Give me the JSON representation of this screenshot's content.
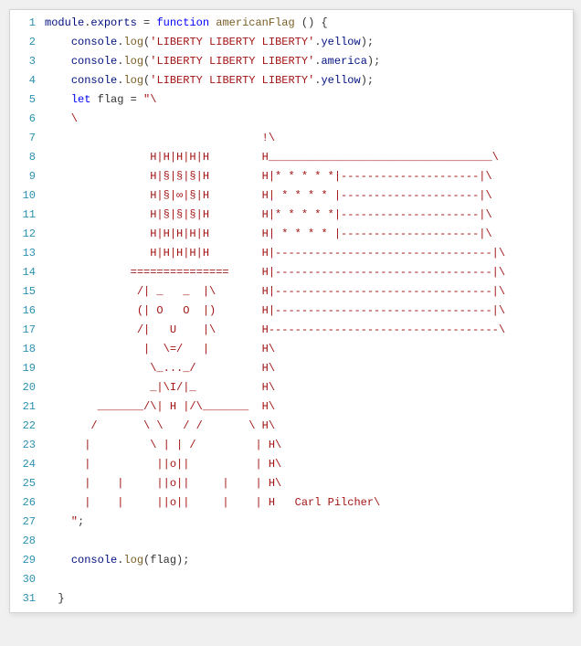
{
  "lines": [
    {
      "n": "1",
      "frags": [
        {
          "t": "module",
          "c": "prop"
        },
        {
          "t": ".",
          "c": "punc"
        },
        {
          "t": "exports",
          "c": "prop"
        },
        {
          "t": " = ",
          "c": "punc"
        },
        {
          "t": "function",
          "c": "kw"
        },
        {
          "t": " ",
          "c": "punc"
        },
        {
          "t": "americanFlag",
          "c": "fn"
        },
        {
          "t": " () {",
          "c": "punc"
        }
      ]
    },
    {
      "n": "2",
      "frags": [
        {
          "t": "    ",
          "c": "punc"
        },
        {
          "t": "console",
          "c": "prop"
        },
        {
          "t": ".",
          "c": "punc"
        },
        {
          "t": "log",
          "c": "fn"
        },
        {
          "t": "(",
          "c": "punc"
        },
        {
          "t": "'LIBERTY LIBERTY LIBERTY'",
          "c": "str"
        },
        {
          "t": ".",
          "c": "punc"
        },
        {
          "t": "yellow",
          "c": "prop"
        },
        {
          "t": ");",
          "c": "punc"
        }
      ]
    },
    {
      "n": "3",
      "frags": [
        {
          "t": "    ",
          "c": "punc"
        },
        {
          "t": "console",
          "c": "prop"
        },
        {
          "t": ".",
          "c": "punc"
        },
        {
          "t": "log",
          "c": "fn"
        },
        {
          "t": "(",
          "c": "punc"
        },
        {
          "t": "'LIBERTY LIBERTY LIBERTY'",
          "c": "str"
        },
        {
          "t": ".",
          "c": "punc"
        },
        {
          "t": "america",
          "c": "prop"
        },
        {
          "t": ");",
          "c": "punc"
        }
      ]
    },
    {
      "n": "4",
      "frags": [
        {
          "t": "    ",
          "c": "punc"
        },
        {
          "t": "console",
          "c": "prop"
        },
        {
          "t": ".",
          "c": "punc"
        },
        {
          "t": "log",
          "c": "fn"
        },
        {
          "t": "(",
          "c": "punc"
        },
        {
          "t": "'LIBERTY LIBERTY LIBERTY'",
          "c": "str"
        },
        {
          "t": ".",
          "c": "punc"
        },
        {
          "t": "yellow",
          "c": "prop"
        },
        {
          "t": ");",
          "c": "punc"
        }
      ]
    },
    {
      "n": "5",
      "frags": [
        {
          "t": "    ",
          "c": "punc"
        },
        {
          "t": "let",
          "c": "kw"
        },
        {
          "t": " flag = ",
          "c": "punc"
        },
        {
          "t": "\"\\",
          "c": "str"
        }
      ]
    },
    {
      "n": "6",
      "frags": [
        {
          "t": "    \\",
          "c": "str"
        }
      ]
    },
    {
      "n": "7",
      "frags": [
        {
          "t": "                                 !\\",
          "c": "str"
        }
      ]
    },
    {
      "n": "8",
      "frags": [
        {
          "t": "                H|H|H|H|H        H__________________________________\\",
          "c": "str"
        }
      ]
    },
    {
      "n": "9",
      "frags": [
        {
          "t": "                H|§|§|§|H        H|* * * * *|---------------------|\\",
          "c": "str"
        }
      ]
    },
    {
      "n": "10",
      "frags": [
        {
          "t": "                H|§|∞|§|H        H| * * * * |---------------------|\\",
          "c": "str"
        }
      ]
    },
    {
      "n": "11",
      "frags": [
        {
          "t": "                H|§|§|§|H        H|* * * * *|---------------------|\\",
          "c": "str"
        }
      ]
    },
    {
      "n": "12",
      "frags": [
        {
          "t": "                H|H|H|H|H        H| * * * * |---------------------|\\",
          "c": "str"
        }
      ]
    },
    {
      "n": "13",
      "frags": [
        {
          "t": "                H|H|H|H|H        H|---------------------------------|\\",
          "c": "str"
        }
      ]
    },
    {
      "n": "14",
      "frags": [
        {
          "t": "             ===============     H|---------------------------------|\\",
          "c": "str"
        }
      ]
    },
    {
      "n": "15",
      "frags": [
        {
          "t": "              /| _   _  |\\       H|---------------------------------|\\",
          "c": "str"
        }
      ]
    },
    {
      "n": "16",
      "frags": [
        {
          "t": "              (| O   O  |)       H|---------------------------------|\\",
          "c": "str"
        }
      ]
    },
    {
      "n": "17",
      "frags": [
        {
          "t": "              /|   U    |\\       H-----------------------------------\\",
          "c": "str"
        }
      ]
    },
    {
      "n": "18",
      "frags": [
        {
          "t": "               |  \\=/   |        H\\",
          "c": "str"
        }
      ]
    },
    {
      "n": "19",
      "frags": [
        {
          "t": "                \\_..._/          H\\",
          "c": "str"
        }
      ]
    },
    {
      "n": "20",
      "frags": [
        {
          "t": "                _|\\I/|_          H\\",
          "c": "str"
        }
      ]
    },
    {
      "n": "21",
      "frags": [
        {
          "t": "        _______/\\| H |/\\_______  H\\",
          "c": "str"
        }
      ]
    },
    {
      "n": "22",
      "frags": [
        {
          "t": "       /       \\ \\   / /       \\ H\\",
          "c": "str"
        }
      ]
    },
    {
      "n": "23",
      "frags": [
        {
          "t": "      |         \\ | | /         | H\\",
          "c": "str"
        }
      ]
    },
    {
      "n": "24",
      "frags": [
        {
          "t": "      |          ||o||          | H\\",
          "c": "str"
        }
      ]
    },
    {
      "n": "25",
      "frags": [
        {
          "t": "      |    |     ||o||     |    | H\\",
          "c": "str"
        }
      ]
    },
    {
      "n": "26",
      "frags": [
        {
          "t": "      |    |     ||o||     |    | H   Carl Pilcher\\",
          "c": "str"
        }
      ]
    },
    {
      "n": "27",
      "frags": [
        {
          "t": "    \"",
          "c": "str"
        },
        {
          "t": ";",
          "c": "punc"
        }
      ]
    },
    {
      "n": "28",
      "frags": [
        {
          "t": "",
          "c": "punc"
        }
      ]
    },
    {
      "n": "29",
      "frags": [
        {
          "t": "    ",
          "c": "punc"
        },
        {
          "t": "console",
          "c": "prop"
        },
        {
          "t": ".",
          "c": "punc"
        },
        {
          "t": "log",
          "c": "fn"
        },
        {
          "t": "(flag);",
          "c": "punc"
        }
      ]
    },
    {
      "n": "30",
      "frags": [
        {
          "t": "",
          "c": "punc"
        }
      ]
    },
    {
      "n": "31",
      "frags": [
        {
          "t": "  }",
          "c": "punc"
        }
      ]
    }
  ]
}
